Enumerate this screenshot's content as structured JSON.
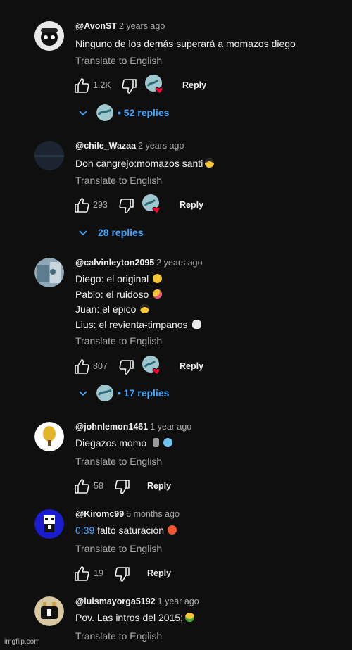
{
  "comments": [
    {
      "handle": "@AvonST",
      "time": "2 years ago",
      "lines": [
        "Ninguno de los demás superará a momazos diego"
      ],
      "translate": "Translate to English",
      "likes": "1.2K",
      "reply": "Reply",
      "replies": "52 replies"
    },
    {
      "handle": "@chile_Wazaa",
      "time": "2 years ago",
      "lines": [
        "Don cangrejo:momazos santi"
      ],
      "translate": "Translate to English",
      "likes": "293",
      "reply": "Reply",
      "replies": "28 replies"
    },
    {
      "handle": "@calvinleyton2095",
      "time": "2 years ago",
      "lines": [
        "Diego: el original",
        "Pablo: el ruidoso",
        "Juan: el épico",
        "Lius: el revienta-timpanos"
      ],
      "translate": "Translate to English",
      "likes": "807",
      "reply": "Reply",
      "replies": "17 replies"
    },
    {
      "handle": "@johnlemon1461",
      "time": "1 year ago",
      "lines": [
        "Diegazos momo"
      ],
      "translate": "Translate to English",
      "likes": "58",
      "reply": "Reply"
    },
    {
      "handle": "@Kiromc99",
      "time": "6 months ago",
      "timestamp_link": "0:39",
      "text_after_link": "faltó saturación",
      "translate": "Translate to English",
      "likes": "19",
      "reply": "Reply"
    },
    {
      "handle": "@luismayorga5192",
      "time": "1 year ago",
      "lines": [
        "Pov. Las intros del 2015;"
      ],
      "translate": "Translate to English"
    }
  ],
  "watermark": "imgflip.com",
  "colors": {
    "background": "#0f0f0f",
    "link": "#3ea6ff",
    "secondary_text": "#aaaaaa",
    "heart": "#ff0033"
  }
}
